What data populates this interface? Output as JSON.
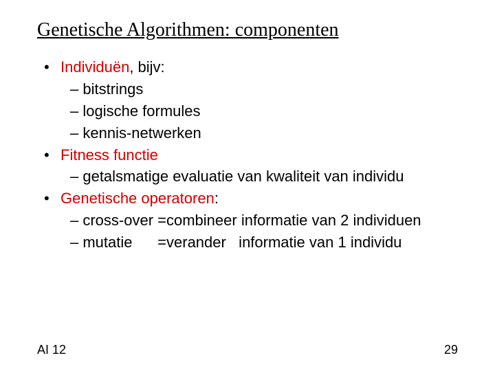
{
  "title": "Genetische Algorithmen: componenten",
  "bullets": {
    "b1": {
      "head_red": "Individuën",
      "head_rest": ", bijv:"
    },
    "b1_subs": {
      "s1": "– bitstrings",
      "s2": "– logische formules",
      "s3": "– kennis-netwerken"
    },
    "b2": {
      "head_red": "Fitness functie"
    },
    "b2_subs": {
      "s1": "– getalsmatige evaluatie van kwaliteit van individu"
    },
    "b3": {
      "head_red": "Genetische operatoren",
      "head_rest": ":"
    },
    "b3_subs": {
      "s1": "– cross-over =combineer informatie van 2 individuen",
      "s2": "– mutatie      =verander   informatie van 1 individu"
    }
  },
  "footer": {
    "left": "AI 12",
    "right": "29"
  }
}
